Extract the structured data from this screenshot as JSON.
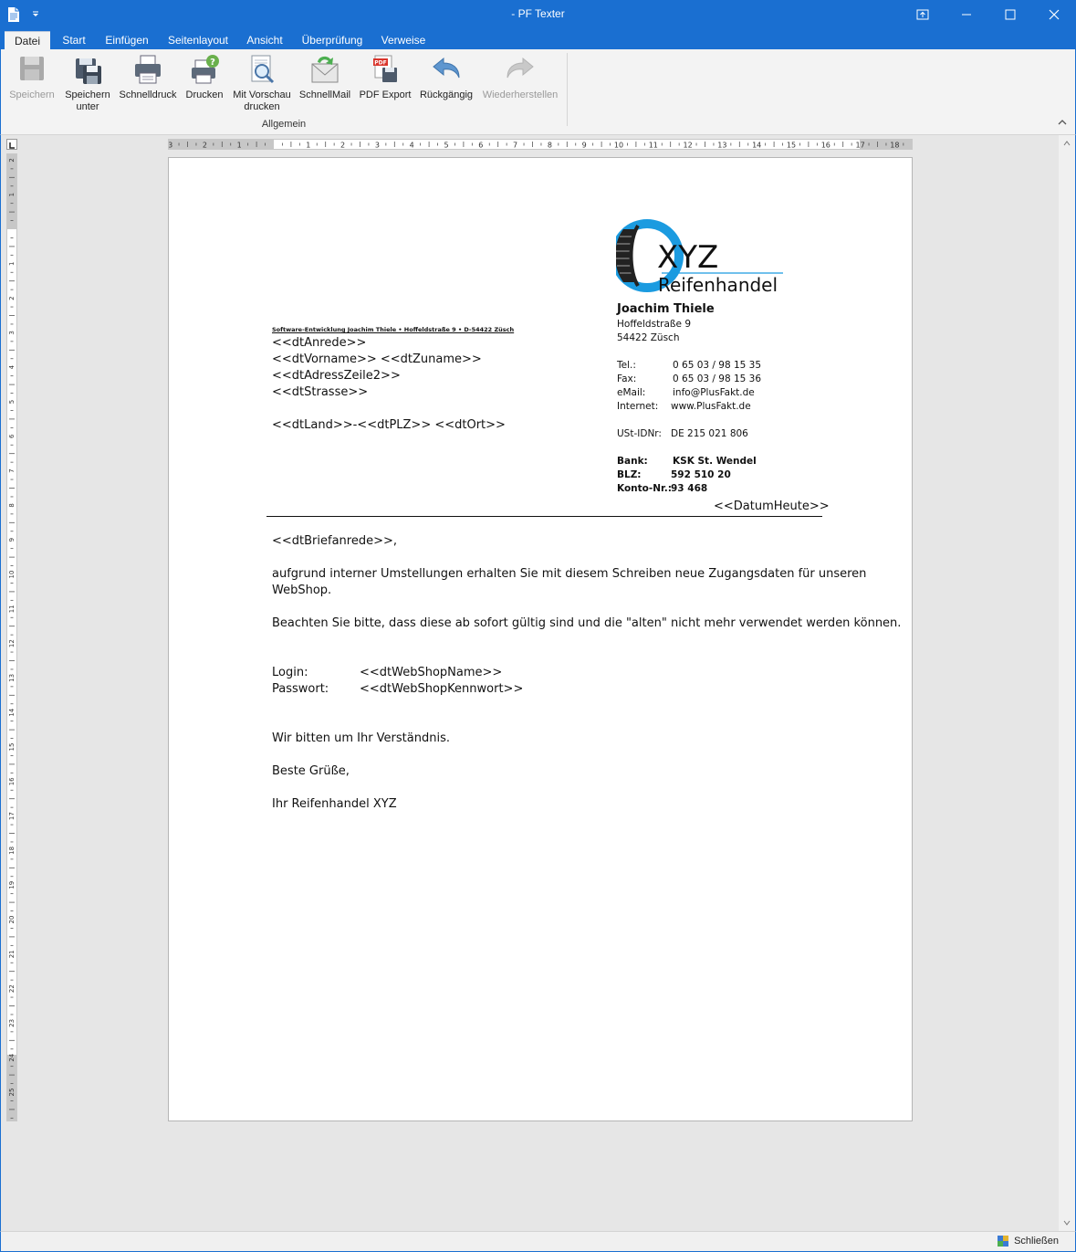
{
  "window": {
    "title": "- PF Texter"
  },
  "tabs": [
    "Datei",
    "Start",
    "Einfügen",
    "Seitenlayout",
    "Ansicht",
    "Überprüfung",
    "Verweise"
  ],
  "ribbon": {
    "group_label": "Allgemein",
    "buttons": [
      {
        "label": "Speichern",
        "disabled": true,
        "icon": "save-icon"
      },
      {
        "label": "Speichern",
        "label2": "unter",
        "icon": "save-as-icon"
      },
      {
        "label": "Schnelldruck",
        "icon": "quick-print-icon"
      },
      {
        "label": "Drucken",
        "icon": "print-icon"
      },
      {
        "label": "Mit Vorschau",
        "label2": "drucken",
        "icon": "print-preview-icon"
      },
      {
        "label": "SchnellMail",
        "icon": "mail-icon"
      },
      {
        "label": "PDF Export",
        "icon": "pdf-export-icon"
      },
      {
        "label": "Rückgängig",
        "icon": "undo-icon"
      },
      {
        "label": "Wiederherstellen",
        "disabled": true,
        "icon": "redo-icon"
      }
    ]
  },
  "ruler": {
    "h_ticks": [
      "3",
      "2",
      "1",
      "1",
      "2",
      "3",
      "4",
      "5",
      "6",
      "7",
      "8",
      "9",
      "10",
      "11",
      "12",
      "13",
      "14",
      "15",
      "16",
      "17",
      "18"
    ],
    "v_ticks": [
      "2",
      "1",
      "1",
      "2",
      "3",
      "4",
      "5",
      "6",
      "7",
      "8",
      "9",
      "10",
      "11",
      "12",
      "13",
      "14",
      "15",
      "16",
      "17",
      "18",
      "19",
      "20",
      "21",
      "22",
      "23",
      "24",
      "25"
    ]
  },
  "letter": {
    "logo": {
      "brand": "XYZ",
      "subtitle": "Reifenhandel"
    },
    "sender_line": "Software-Entwicklung Joachim Thiele • Hoffeldstraße 9 • D-54422 Züsch",
    "address_lines": [
      "<<dtAnrede>>",
      "<<dtVorname>> <<dtZuname>>",
      "<<dtAdressZeile2>>",
      "<<dtStrasse>>",
      "",
      "<<dtLand>>-<<dtPLZ>> <<dtOrt>>"
    ],
    "contact": {
      "name": "Joachim Thiele",
      "street": "Hoffeldstraße 9",
      "city": "54422 Züsch",
      "tel_label": "Tel.:",
      "tel": "0 65 03 / 98 15 35",
      "fax_label": "Fax:",
      "fax": "0 65 03 / 98 15 36",
      "email_label": "eMail:",
      "email": "info@PlusFakt.de",
      "web_label": "Internet:",
      "web": "www.PlusFakt.de",
      "vat_label": "USt-IDNr:",
      "vat": "DE 215 021 806",
      "bank_label": "Bank:",
      "bank": "KSK St. Wendel",
      "blz_label": "BLZ:",
      "blz": "592 510 20",
      "konto_label": "Konto-Nr.:",
      "konto": "93 468"
    },
    "date": "<<DatumHeute>>",
    "salutation": "<<dtBriefanrede>>,",
    "para1_line1": "aufgrund interner Umstellungen erhalten Sie mit diesem Schreiben neue Zugangsdaten für unseren",
    "para1_line2": "WebShop.",
    "para2": "Beachten Sie bitte, dass diese ab sofort gültig sind und die \"alten\" nicht mehr verwendet werden können.",
    "login_label": "Login:",
    "login_value": "<<dtWebShopName>>",
    "password_label": "Passwort:",
    "password_value": "<<dtWebShopKennwort>>",
    "closing1": "Wir bitten um Ihr Verständnis.",
    "closing2": "Beste Grüße,",
    "signature": "Ihr Reifenhandel XYZ"
  },
  "statusbar": {
    "close_label": "Schließen"
  },
  "colors": {
    "titlebar": "#1a6fd1",
    "logo_blue": "#1b9be0"
  }
}
